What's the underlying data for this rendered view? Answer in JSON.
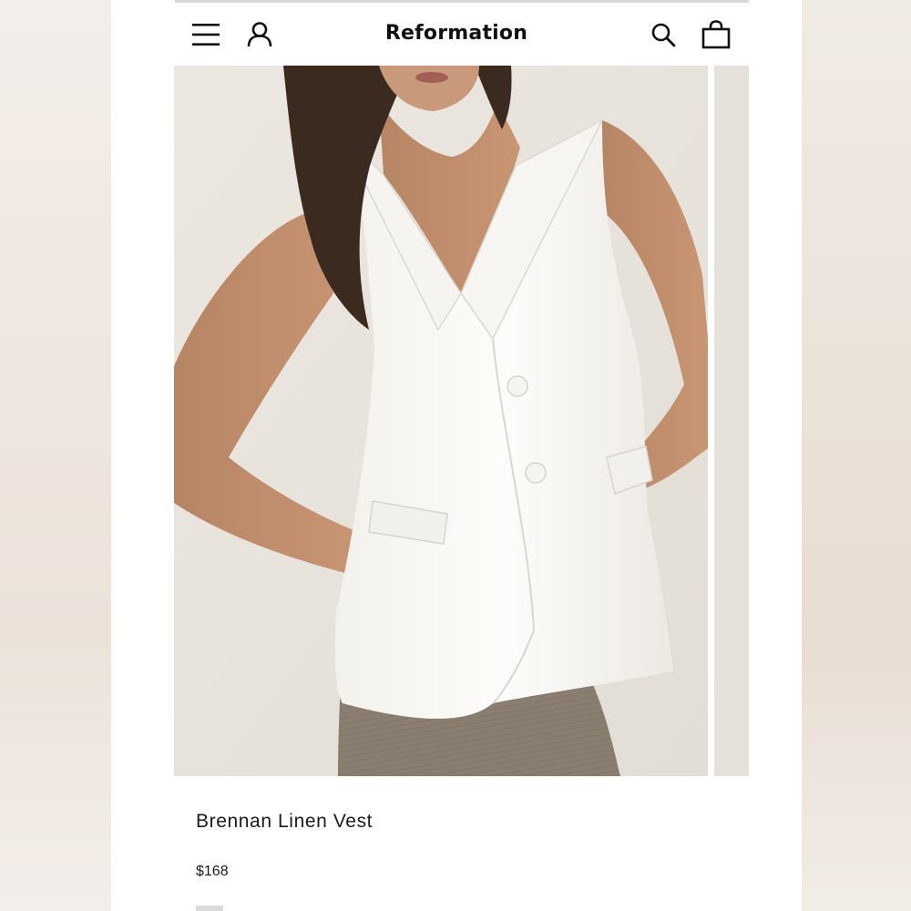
{
  "header": {
    "brand": "Reformation",
    "icons": {
      "menu": "hamburger-menu-icon",
      "account": "user-icon",
      "search": "search-icon",
      "bag": "shopping-bag-icon"
    }
  },
  "product": {
    "name": "Brennan Linen Vest",
    "price": "$168",
    "image_alt": "Model wearing white halter linen vest with gray trousers"
  },
  "colors": {
    "background": "#ffffff",
    "text": "#111111",
    "vest": "#fbfaf7",
    "trousers": "#8a7e70"
  }
}
